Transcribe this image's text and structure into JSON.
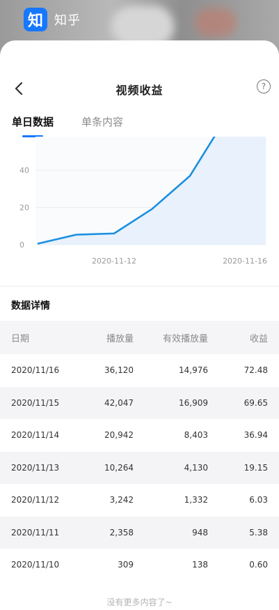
{
  "app": {
    "icon_char": "知",
    "name": "知乎",
    "accent": "#1677ff"
  },
  "nav": {
    "title": "视频收益",
    "help_char": "?"
  },
  "tabs": [
    {
      "label": "单日数据",
      "active": true
    },
    {
      "label": "单条内容",
      "active": false
    }
  ],
  "chart_data": {
    "type": "area",
    "y_ticks": [
      "0",
      "20",
      "40"
    ],
    "ylim": [
      0,
      58
    ],
    "x_tick_labels": [
      "2020-11-12",
      "2020-11-16"
    ],
    "x": [
      "2020-11-10",
      "2020-11-11",
      "2020-11-12",
      "2020-11-13",
      "2020-11-14",
      "2020-11-15",
      "2020-11-16"
    ],
    "series": [
      {
        "values": [
          0.6,
          5.38,
          6.03,
          19.15,
          36.94,
          69.65,
          72.48
        ]
      }
    ],
    "line_color": "#1a8fe0",
    "fill_color": "#e8f1fc",
    "grid": true
  },
  "section": {
    "title": "数据详情"
  },
  "table": {
    "headers": [
      "日期",
      "播放量",
      "有效播放量",
      "收益"
    ],
    "rows": [
      [
        "2020/11/16",
        "36,120",
        "14,976",
        "72.48"
      ],
      [
        "2020/11/15",
        "42,047",
        "16,909",
        "69.65"
      ],
      [
        "2020/11/14",
        "20,942",
        "8,403",
        "36.94"
      ],
      [
        "2020/11/13",
        "10,264",
        "4,130",
        "19.15"
      ],
      [
        "2020/11/12",
        "3,242",
        "1,332",
        "6.03"
      ],
      [
        "2020/11/11",
        "2,358",
        "948",
        "5.38"
      ],
      [
        "2020/11/10",
        "309",
        "138",
        "0.60"
      ]
    ]
  },
  "footer": {
    "note": "没有更多内容了~"
  }
}
